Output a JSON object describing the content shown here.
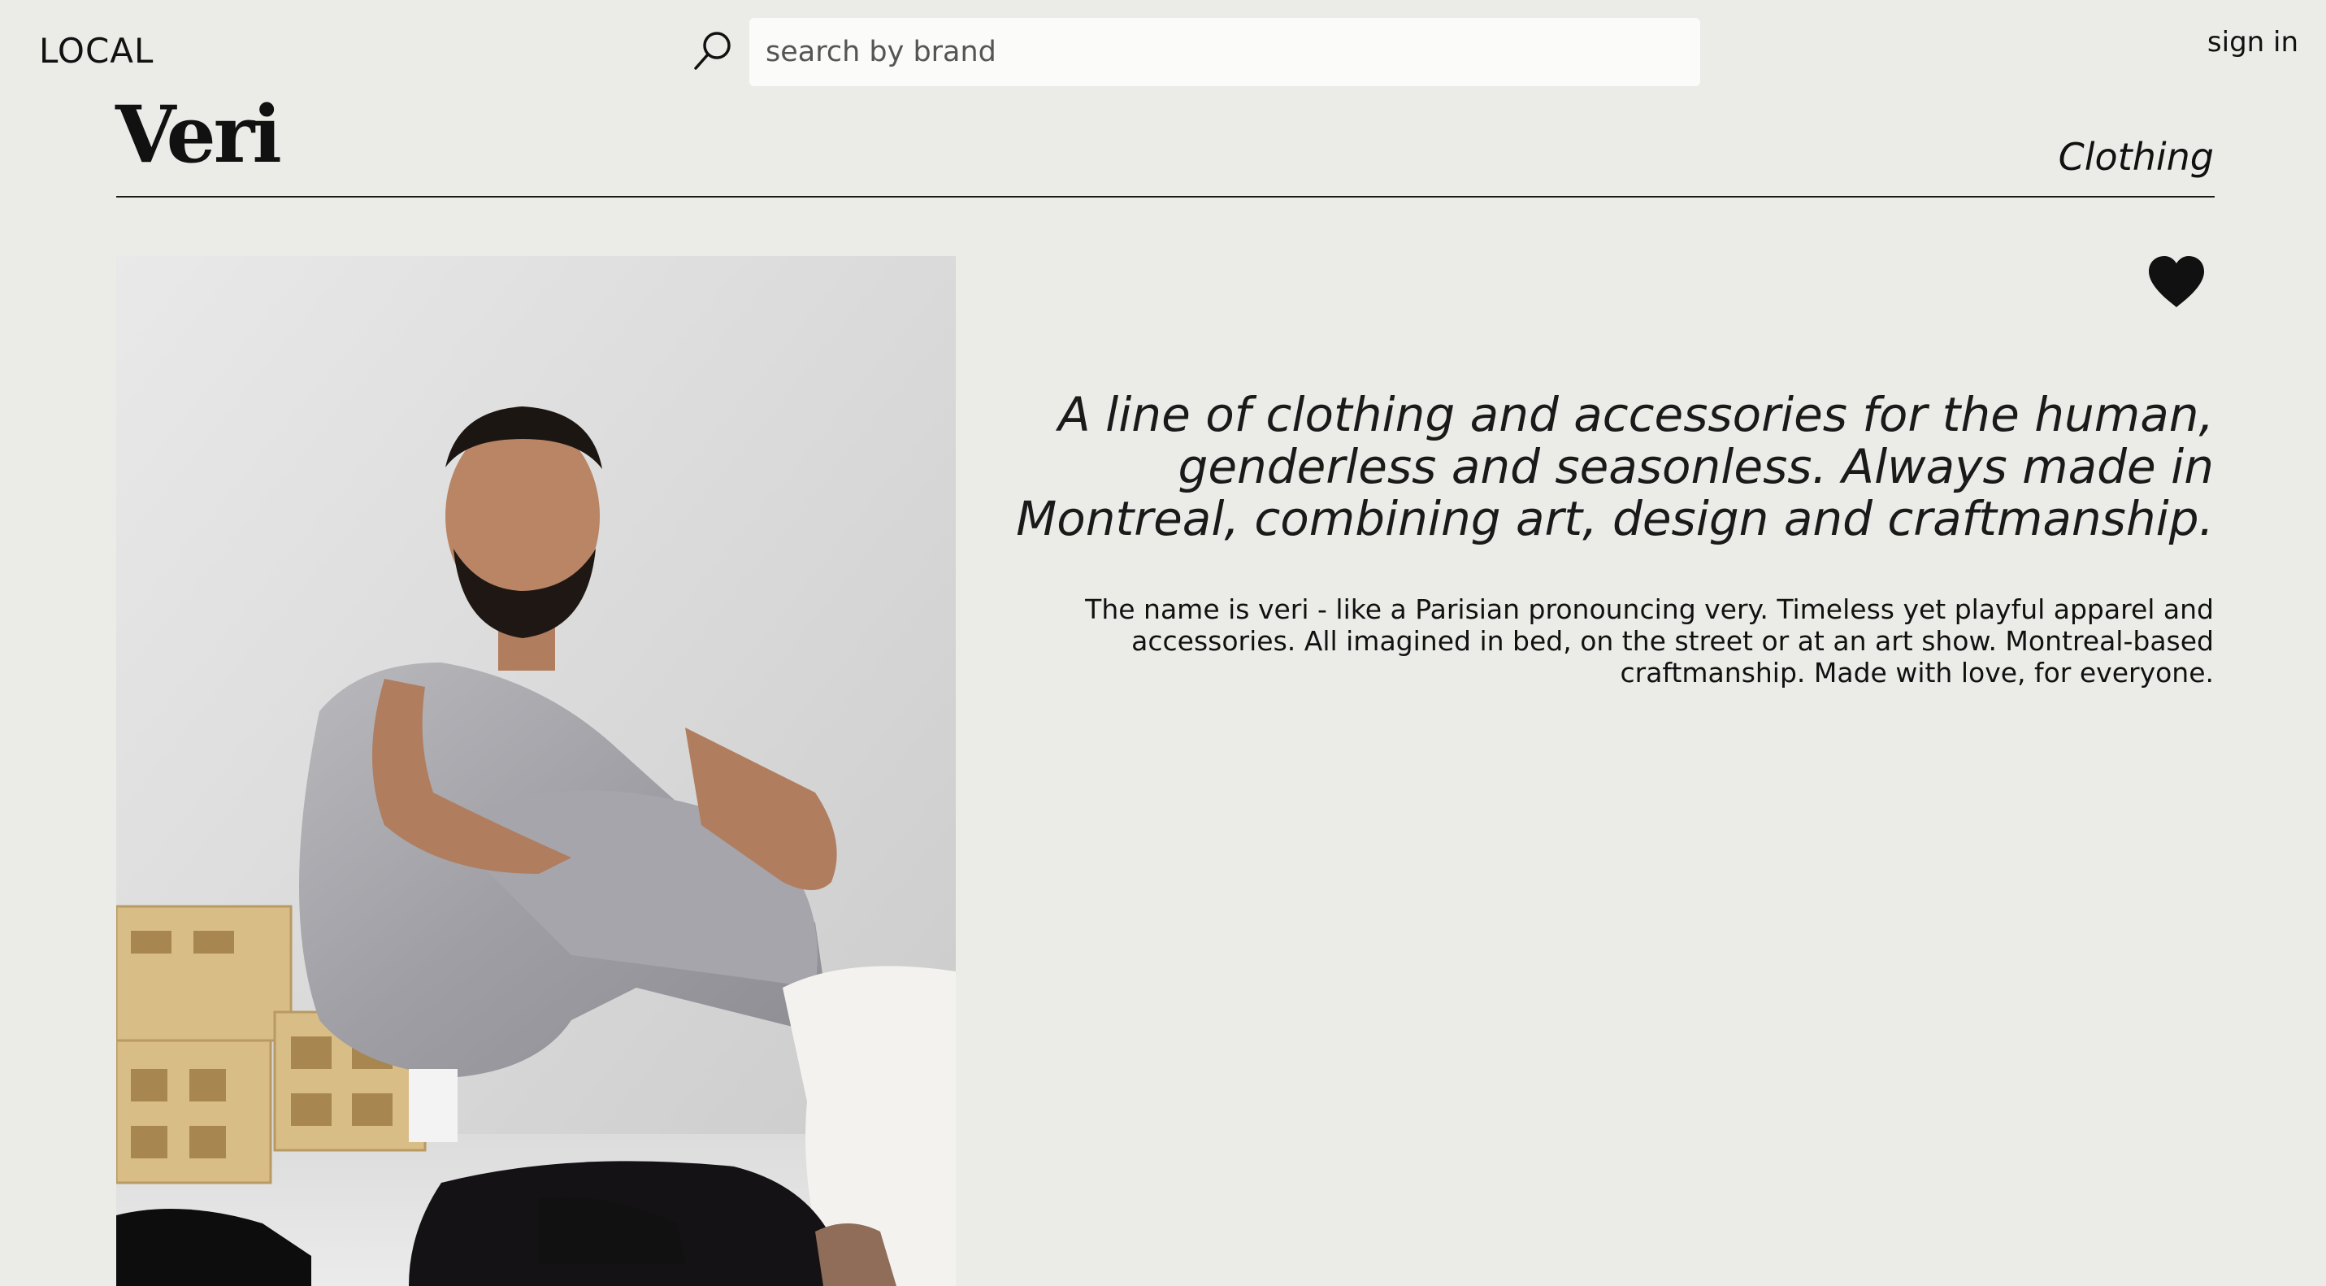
{
  "header": {
    "logo": "LOCAL",
    "search": {
      "placeholder": "search by brand",
      "value": ""
    },
    "sign_in_label": "sign in"
  },
  "brand": {
    "name": "Veri",
    "category": "Clothing",
    "favorited": true,
    "tagline": "A line of clothing and accessories for the human, genderless and seasonless. Always made in Montreal, combining art, design and craftmanship.",
    "description": "The name is veri - like a Parisian pronouncing very. Timeless yet playful apparel and accessories. All imagined in bed, on the street or at an art show. Montreal-based craftmanship. Made with love, for everyone."
  },
  "icons": {
    "search": "search-icon",
    "favorite": "heart-icon"
  },
  "colors": {
    "background": "#ebebe8",
    "text": "#1a1a1a",
    "search_field": "#fbfbfa",
    "heart": "#111111"
  }
}
